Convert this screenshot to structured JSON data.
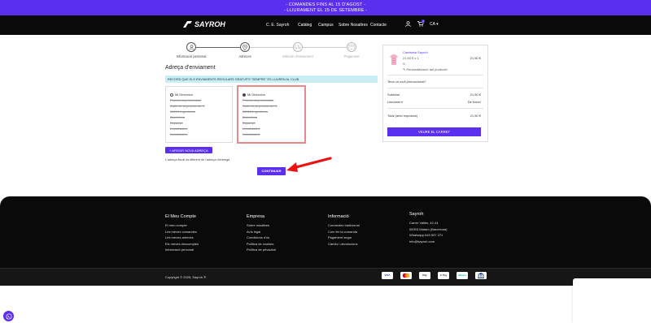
{
  "promo": {
    "line1": "- COMANDES FINS AL 15 D'AGOST -",
    "line2": "- LLIURAMENT EL 15 DE SETEMBRE -"
  },
  "nav": {
    "brand": "SAYROH",
    "links": [
      "C. E. Sayroh",
      "Catàleg",
      "Campus",
      "Sobre Nosaltres",
      "Contacte"
    ],
    "lang": "CA",
    "cart_count": "1"
  },
  "steps": [
    {
      "label": "Informació personal",
      "icon": "person-icon",
      "state": "done"
    },
    {
      "label": "Adreces",
      "icon": "pin-icon",
      "state": "current"
    },
    {
      "label": "Mètode d'enviament",
      "icon": "truck-icon",
      "state": "pending"
    },
    {
      "label": "Pagament",
      "icon": "card-icon",
      "state": "pending"
    }
  ],
  "address": {
    "title": "Adreça d'enviament",
    "notice": "RECORD QUE ELS ENVIAMENTS REGULARS GRATUÏTS \"SEMPRE\" ES LLIUREN AL CLUB",
    "cards": [
      {
        "name": "Mi Dirección",
        "lines": [
          "Prueba sayrohmatato",
          "Calle de la prueba de, 1",
          "08010 Ingenieros",
          "Barcelona",
          "Espanya",
          "Localidades",
          "Localidades"
        ],
        "selected": false
      },
      {
        "name": "Mi Dirección",
        "lines": [
          "Prueba sayrohmatato",
          "Calle de la prueba de, 1",
          "08010 Ingenieros",
          "Barcelona",
          "Espanya",
          "Localidades",
          "Localidades"
        ],
        "selected": true
      }
    ],
    "add_button": "+ AFEGIR NOVA ADREÇA",
    "note": "L'adreça fiscal és diferent de l'adreça d'entrega",
    "continue_button": "CONTINUAR"
  },
  "summary": {
    "product_title": "Camiseta Sayroh",
    "qty_line": "21,50 € x 1",
    "min_line": "S",
    "custom_line": "Personalització del producte",
    "product_price": "21,50 €",
    "promo_label": "Tens un codi promocional?",
    "subtotal_label": "Subtotal",
    "subtotal_value": "21,50 €",
    "shipping_label": "Lliurament",
    "shipping_value": "De franc!",
    "total_label": "Total (amb impostos)",
    "total_value": "21,50 €",
    "cart_button": "VEURE EL CARRET"
  },
  "footer": {
    "cols": [
      {
        "heading": "El Meu Compte",
        "items": [
          "El meu compte",
          "Les meves comandes",
          "Les meves adreces",
          "Els meves descomptes",
          "Informació personal"
        ]
      },
      {
        "heading": "Empresa",
        "items": [
          "Sobre nosaltres",
          "Avís legal",
          "Condicions d'ús",
          "Política de cookies",
          "Política de privacitat"
        ]
      },
      {
        "heading": "Informació",
        "items": [
          "Comandes tradicional",
          "Com fer la comanda",
          "Pagament segur",
          "Canvis i devolucions"
        ]
      },
      {
        "heading": "Sayroh",
        "items": [
          "Carrer Vallès, 42-44",
          "08303 Mataró (Barcelona)",
          "Whatsapp 640 597 271",
          "info@sayroh.com"
        ]
      }
    ],
    "copyright": "Copyright © 2025, Sayroh ®",
    "payments": [
      "VISA",
      "MC",
      "Pay",
      "G Pay",
      "Bizum",
      "Bank"
    ]
  },
  "colors": {
    "accent": "#5b2ff0",
    "dark": "#0a0a0a"
  }
}
